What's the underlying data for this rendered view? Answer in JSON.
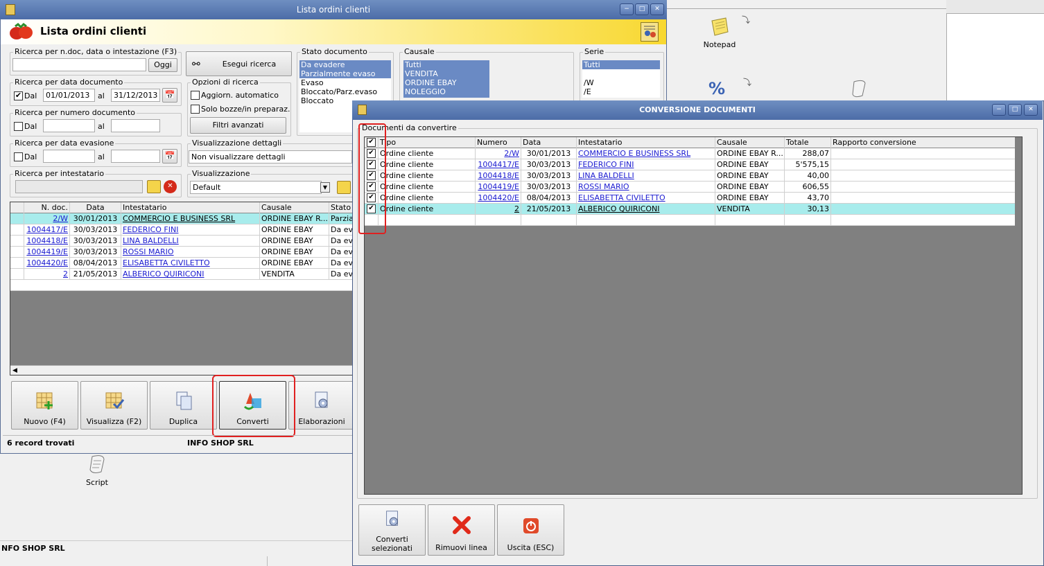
{
  "desktop": {
    "icons": [
      {
        "label": "Notepad"
      },
      {
        "label": "Script"
      }
    ],
    "bottom_status": "NFO SHOP SRL"
  },
  "main": {
    "title": "Lista ordini clienti",
    "header_title": "Lista ordini clienti",
    "search_text": {
      "legend": "Ricerca per n.doc, data o intestazione (F3)",
      "value": "",
      "button": "Oggi"
    },
    "search_button": "Esegui ricerca",
    "date_doc": {
      "legend": "Ricerca per data documento",
      "from_label": "Dal",
      "from": "01/01/2013",
      "to_label": "al",
      "to": "31/12/2013",
      "checked": true
    },
    "num_doc": {
      "legend": "Ricerca per numero documento",
      "from_label": "Dal",
      "to_label": "al",
      "from": "",
      "to": ""
    },
    "date_eva": {
      "legend": "Ricerca per data evasione",
      "from_label": "Dal",
      "to_label": "al",
      "from": "",
      "to": ""
    },
    "holder": {
      "legend": "Ricerca per intestatario",
      "value": ""
    },
    "options": {
      "legend": "Opzioni di ricerca",
      "auto": "Aggiorn. automatico",
      "drafts": "Solo bozze/in preparaz.",
      "advanced": "Filtri avanzati"
    },
    "details": {
      "legend": "Visualizzazione dettagli",
      "value": "Non visualizzare dettagli"
    },
    "view": {
      "legend": "Visualizzazione",
      "value": "Default"
    },
    "stato": {
      "legend": "Stato documento",
      "items": [
        "Da evadere",
        "Parzialmente evaso",
        "Evaso",
        "Bloccato/Parz.evaso",
        "Bloccato"
      ]
    },
    "causale": {
      "legend": "Causale",
      "items": [
        "Tutti",
        "VENDITA",
        "ORDINE EBAY",
        "NOLEGGIO"
      ]
    },
    "serie": {
      "legend": "Serie",
      "items": [
        "Tutti",
        "",
        "/W",
        "/E"
      ]
    },
    "grid": {
      "headers": [
        "N. doc.",
        "Data",
        "Intestatario",
        "Causale",
        "Stato"
      ],
      "rows": [
        [
          "2/W",
          "30/01/2013",
          "COMMERCIO E BUSINESS SRL",
          "ORDINE EBAY R...",
          "Parzia"
        ],
        [
          "1004417/E",
          "30/03/2013",
          "FEDERICO FINI",
          "ORDINE EBAY",
          "Da eva"
        ],
        [
          "1004418/E",
          "30/03/2013",
          "LINA BALDELLI",
          "ORDINE EBAY",
          "Da eva"
        ],
        [
          "1004419/E",
          "30/03/2013",
          "ROSSI MARIO",
          "ORDINE EBAY",
          "Da eva"
        ],
        [
          "1004420/E",
          "08/04/2013",
          "ELISABETTA CIVILETTO",
          "ORDINE EBAY",
          "Da eva"
        ],
        [
          "2",
          "21/05/2013",
          "ALBERICO QUIRICONI",
          "VENDITA",
          "Da eva"
        ]
      ]
    },
    "actions": [
      "Nuovo (F4)",
      "Visualizza (F2)",
      "Duplica",
      "Converti",
      "Elaborazioni"
    ],
    "status_left": "6 record trovati",
    "status_right": "INFO SHOP SRL"
  },
  "dialog": {
    "title": "CONVERSIONE DOCUMENTI",
    "legend": "Documenti da convertire",
    "headers": [
      "Tipo",
      "Numero",
      "Data",
      "Intestatario",
      "Causale",
      "Totale",
      "Rapporto conversione"
    ],
    "rows": [
      [
        "Ordine cliente",
        "2/W",
        "30/01/2013",
        "COMMERCIO E BUSINESS SRL",
        "ORDINE EBAY R...",
        "288,07",
        ""
      ],
      [
        "Ordine cliente",
        "1004417/E",
        "30/03/2013",
        "FEDERICO FINI",
        "ORDINE EBAY",
        "5'575,15",
        ""
      ],
      [
        "Ordine cliente",
        "1004418/E",
        "30/03/2013",
        "LINA BALDELLI",
        "ORDINE EBAY",
        "40,00",
        ""
      ],
      [
        "Ordine cliente",
        "1004419/E",
        "30/03/2013",
        "ROSSI MARIO",
        "ORDINE EBAY",
        "606,55",
        ""
      ],
      [
        "Ordine cliente",
        "1004420/E",
        "08/04/2013",
        "ELISABETTA CIVILETTO",
        "ORDINE EBAY",
        "43,70",
        ""
      ],
      [
        "Ordine cliente",
        "2",
        "21/05/2013",
        "ALBERICO QUIRICONI",
        "VENDITA",
        "30,13",
        ""
      ]
    ],
    "buttons": [
      "Converti selezionati",
      "Rimuovi linea",
      "Uscita (ESC)"
    ]
  }
}
